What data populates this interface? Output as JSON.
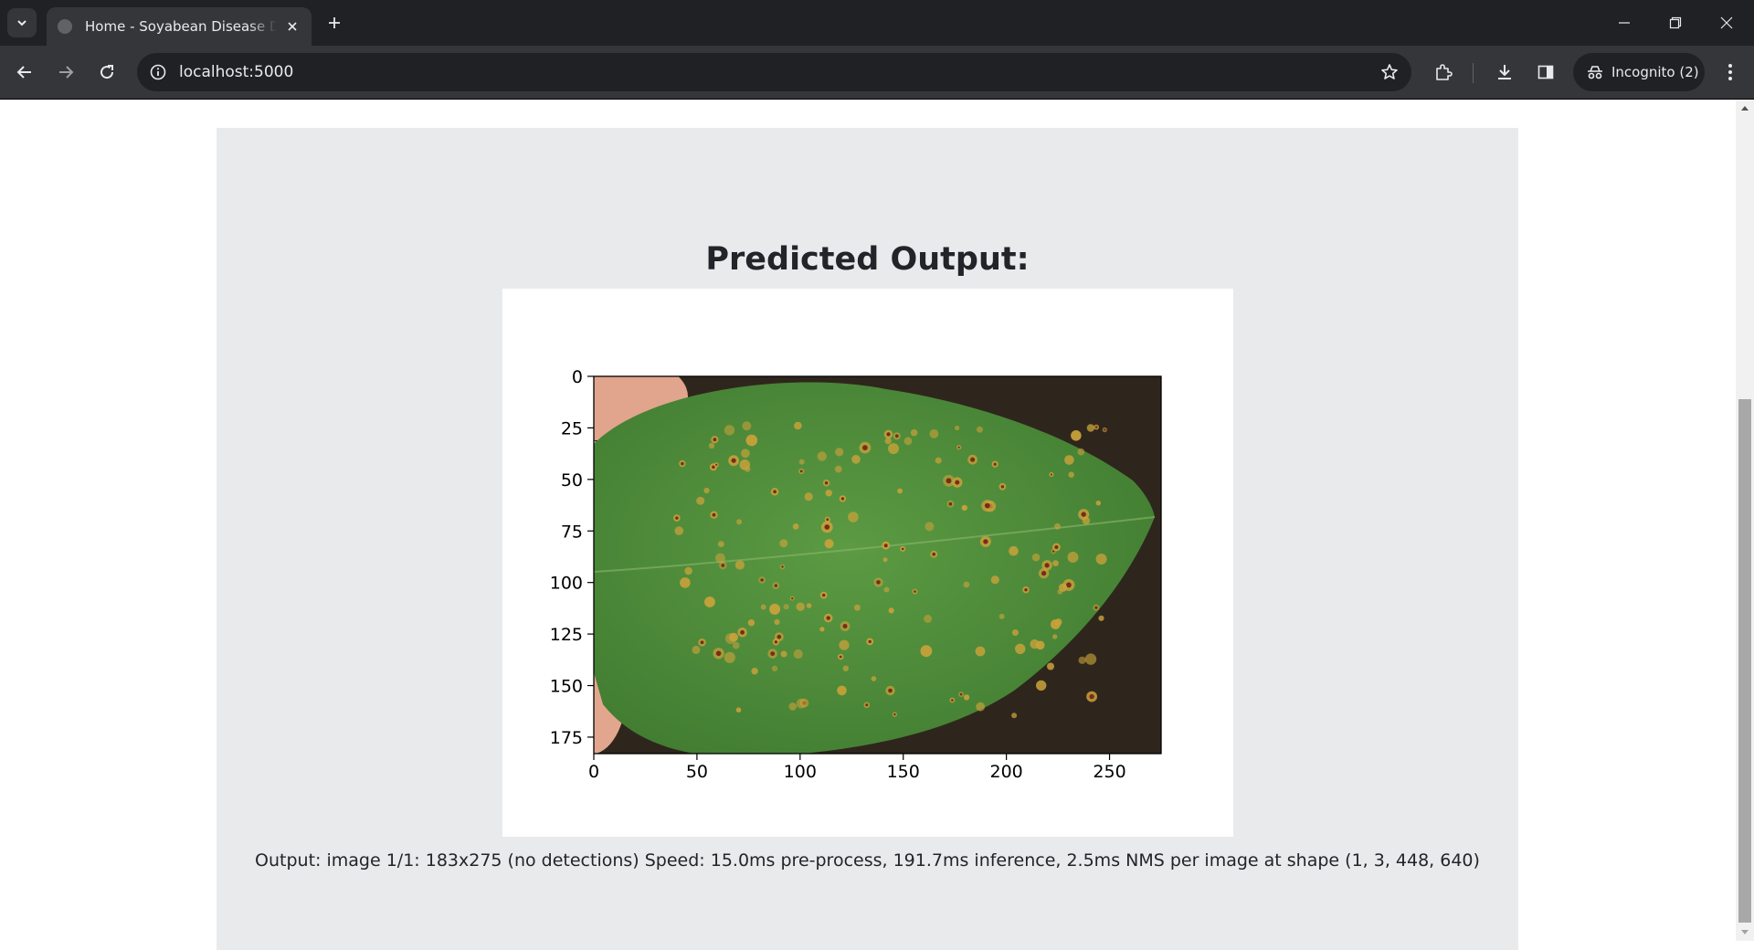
{
  "browser": {
    "tab_title": "Home - Soyabean Disease Detection",
    "url": "localhost:5000",
    "incognito_label": "Incognito (2)"
  },
  "page": {
    "title": "Predicted Output:",
    "output_text": "Output: image 1/1: 183x275 (no detections) Speed: 15.0ms pre-process, 191.7ms inference, 2.5ms NMS per image at shape (1, 3, 448, 640)"
  },
  "chart_data": {
    "type": "image",
    "image_width": 275,
    "image_height": 183,
    "x_ticks": [
      "0",
      "50",
      "100",
      "150",
      "200",
      "250"
    ],
    "y_ticks": [
      "0",
      "25",
      "50",
      "75",
      "100",
      "125",
      "150",
      "175"
    ],
    "x_range": [
      0,
      275
    ],
    "y_range": [
      0,
      183
    ]
  },
  "colors": {
    "leaf": "#4f8a3a",
    "background": "#2e261d",
    "lesion": "#c9a23a",
    "lesion_core": "#7a2a1a"
  }
}
